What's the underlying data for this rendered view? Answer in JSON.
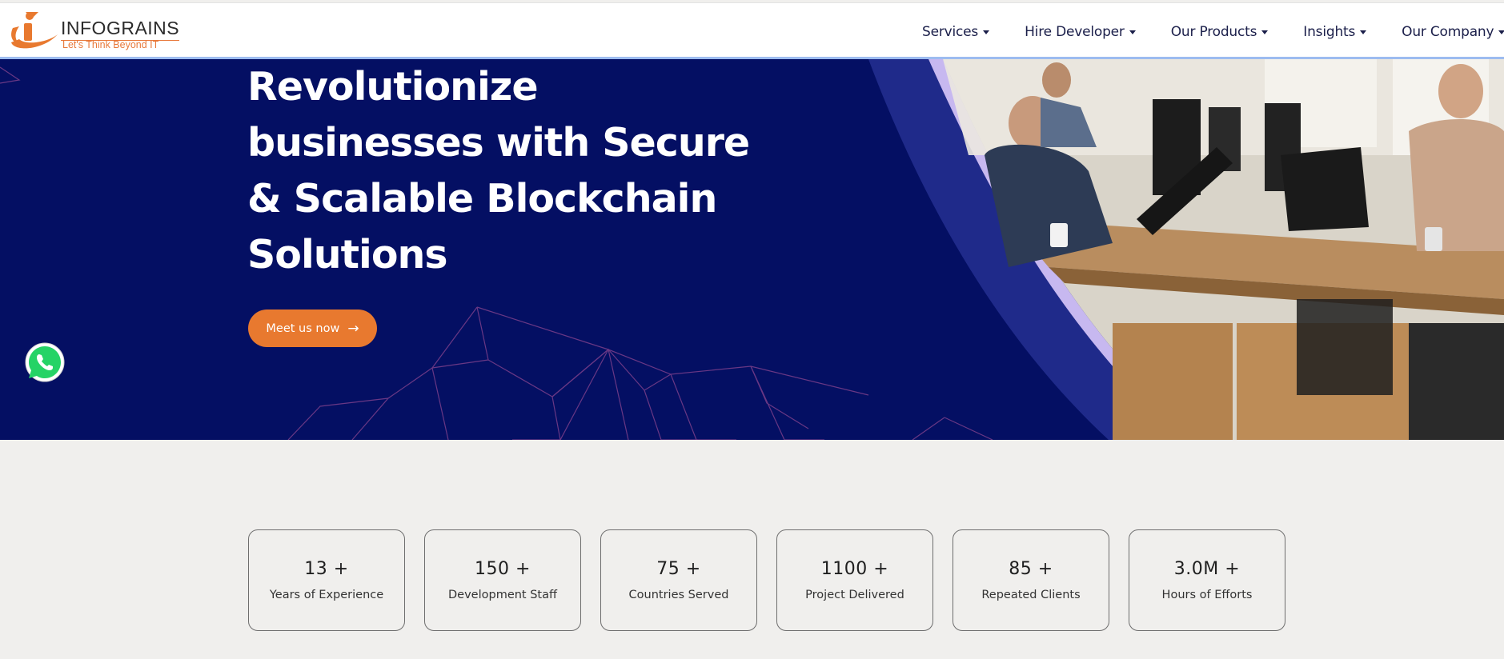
{
  "brand": {
    "name": "INFOGRAINS",
    "tagline": "Let's Think Beyond IT",
    "colors": {
      "orange": "#e8792f",
      "navy": "#040f63",
      "nav_text": "#1b1f4a"
    }
  },
  "nav": {
    "items": [
      {
        "label": "Services"
      },
      {
        "label": "Hire Developer"
      },
      {
        "label": "Our Products"
      },
      {
        "label": "Insights"
      },
      {
        "label": "Our Company"
      }
    ]
  },
  "hero": {
    "title_lines": [
      "Revolutionize",
      "businesses with Secure",
      "& Scalable Blockchain",
      "Solutions"
    ],
    "cta_label": "Meet us now",
    "cta_icon": "arrow-right-icon",
    "image_alt": "team working at computers in office"
  },
  "floating": {
    "whatsapp_icon": "whatsapp-icon"
  },
  "stats": [
    {
      "value": "13 +",
      "label": "Years of Experience"
    },
    {
      "value": "150 +",
      "label": "Development Staff"
    },
    {
      "value": "75 +",
      "label": "Countries Served"
    },
    {
      "value": "1100 +",
      "label": "Project Delivered"
    },
    {
      "value": "85 +",
      "label": "Repeated Clients"
    },
    {
      "value": "3.0M +",
      "label": "Hours of Efforts"
    }
  ]
}
